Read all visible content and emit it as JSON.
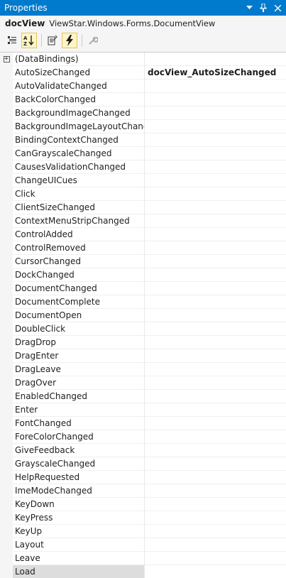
{
  "window": {
    "title": "Properties",
    "dropdown_icon": "chevron-down-icon",
    "pin_icon": "pin-icon",
    "close_icon": "close-icon"
  },
  "object": {
    "name": "docView",
    "type": "ViewStar.Windows.Forms.DocumentView"
  },
  "toolbar": {
    "buttons": [
      {
        "name": "categorized-button",
        "icon": "categorized-icon",
        "active": false
      },
      {
        "name": "alphabetical-button",
        "icon": "sort-az-icon",
        "active": true
      },
      {
        "name": "properties-button",
        "icon": "properties-icon",
        "active": false
      },
      {
        "name": "events-button",
        "icon": "lightning-icon",
        "active": true
      },
      {
        "name": "property-pages-button",
        "icon": "wrench-icon",
        "active": false
      }
    ]
  },
  "events": [
    {
      "name": "(DataBindings)",
      "value": "",
      "expander": "+"
    },
    {
      "name": "AutoSizeChanged",
      "value": "docView_AutoSizeChanged"
    },
    {
      "name": "AutoValidateChanged",
      "value": ""
    },
    {
      "name": "BackColorChanged",
      "value": ""
    },
    {
      "name": "BackgroundImageChanged",
      "value": ""
    },
    {
      "name": "BackgroundImageLayoutChanged",
      "value": ""
    },
    {
      "name": "BindingContextChanged",
      "value": ""
    },
    {
      "name": "CanGrayscaleChanged",
      "value": ""
    },
    {
      "name": "CausesValidationChanged",
      "value": ""
    },
    {
      "name": "ChangeUICues",
      "value": ""
    },
    {
      "name": "Click",
      "value": ""
    },
    {
      "name": "ClientSizeChanged",
      "value": ""
    },
    {
      "name": "ContextMenuStripChanged",
      "value": ""
    },
    {
      "name": "ControlAdded",
      "value": ""
    },
    {
      "name": "ControlRemoved",
      "value": ""
    },
    {
      "name": "CursorChanged",
      "value": ""
    },
    {
      "name": "DockChanged",
      "value": ""
    },
    {
      "name": "DocumentChanged",
      "value": ""
    },
    {
      "name": "DocumentComplete",
      "value": ""
    },
    {
      "name": "DocumentOpen",
      "value": ""
    },
    {
      "name": "DoubleClick",
      "value": ""
    },
    {
      "name": "DragDrop",
      "value": ""
    },
    {
      "name": "DragEnter",
      "value": ""
    },
    {
      "name": "DragLeave",
      "value": ""
    },
    {
      "name": "DragOver",
      "value": ""
    },
    {
      "name": "EnabledChanged",
      "value": ""
    },
    {
      "name": "Enter",
      "value": ""
    },
    {
      "name": "FontChanged",
      "value": ""
    },
    {
      "name": "ForeColorChanged",
      "value": ""
    },
    {
      "name": "GiveFeedback",
      "value": ""
    },
    {
      "name": "GrayscaleChanged",
      "value": ""
    },
    {
      "name": "HelpRequested",
      "value": ""
    },
    {
      "name": "ImeModeChanged",
      "value": ""
    },
    {
      "name": "KeyDown",
      "value": ""
    },
    {
      "name": "KeyPress",
      "value": ""
    },
    {
      "name": "KeyUp",
      "value": ""
    },
    {
      "name": "Layout",
      "value": ""
    },
    {
      "name": "Leave",
      "value": ""
    },
    {
      "name": "Load",
      "value": "",
      "selected": true
    }
  ],
  "colors": {
    "title_bar": "#007acc",
    "selected_row": "#dddddd",
    "active_button": "#fff4c4"
  }
}
